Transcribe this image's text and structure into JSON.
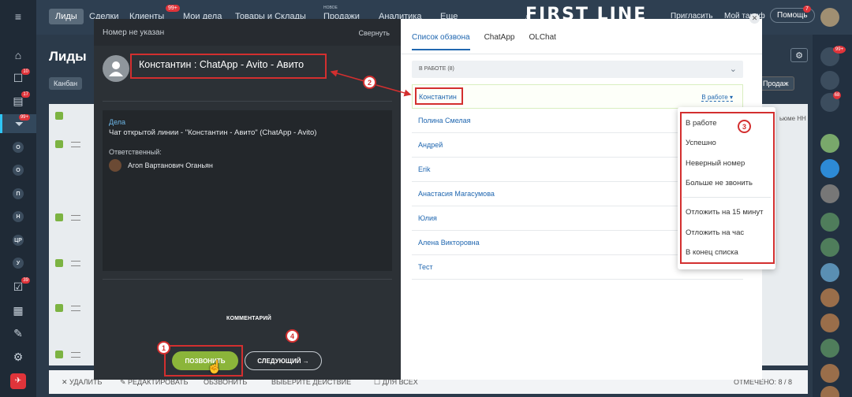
{
  "topbar": {
    "current_tab": "Лиды",
    "links": [
      "Сделки",
      "Клиенты",
      "Мои дела",
      "Товары и Склады",
      "Продажи",
      "Аналитика",
      "Еще"
    ],
    "clients_badge": "99+",
    "new_label": "НОВОЕ",
    "logo": "FIRST LINE",
    "invite": "Пригласить",
    "plan": "Мой тариф",
    "help": "Помощь",
    "help_badge": "7"
  },
  "sidebar": {
    "badges": [
      "10",
      "17",
      "99+",
      "39"
    ],
    "letters": [
      "О",
      "О",
      "П",
      "Н",
      "ЦР",
      "У"
    ]
  },
  "page": {
    "title": "Лиды",
    "kanban": "Канбан",
    "prodazh": "Продаж",
    "nh": "ьюме НН",
    "bottom": {
      "delete": "УДАЛИТЬ",
      "edit": "РЕДАКТИРОВАТЬ",
      "call": "ОБЗВОНИТЬ",
      "choose": "ВЫБЕРИТЕ ДЕЙСТВИЕ",
      "all": "ДЛЯ ВСЕХ",
      "counter": "ОТМЕЧЕНО: 8 / 8"
    }
  },
  "right_panel": {
    "top_badges": [
      "99+",
      "68"
    ]
  },
  "modal": {
    "header_title": "Номер не указан",
    "collapse": "Свернуть",
    "contact_name": "Константин : ChatApp - Avito - Авито",
    "tasks_label": "Дела",
    "task_text": "Чат открытой линии - \"Константин - Авито\" (ChatApp - Avito)",
    "responsible_label": "Ответственный:",
    "responsible_name": "Агоп Вартанович Оганьян",
    "comment": "КОММЕНТАРИЙ",
    "call_button": "ПОЗВОНИТЬ",
    "next_button": "СЛЕДУЮЩИЙ"
  },
  "call_list": {
    "tabs": [
      "Список обзвона",
      "ChatApp",
      "OLChat"
    ],
    "status_header": "В РАБОТЕ (8)",
    "current_status": "В работе",
    "contacts": [
      "Константин",
      "Полина Смелая",
      "Андрей",
      "Erik",
      "Анастасия Магасумова",
      "Юлия",
      "Алена Викторовна",
      "Тест"
    ]
  },
  "status_dropdown": {
    "options": [
      "В работе",
      "Успешно",
      "Неверный номер",
      "Больше не звонить",
      "Отложить на 15 минут",
      "Отложить на час",
      "В конец списка"
    ]
  },
  "annotations": [
    "1",
    "2",
    "3",
    "4"
  ],
  "colors": {
    "accent": "#2067b0",
    "call_green": "#8bb53a",
    "annotation_red": "#d32f2f"
  }
}
